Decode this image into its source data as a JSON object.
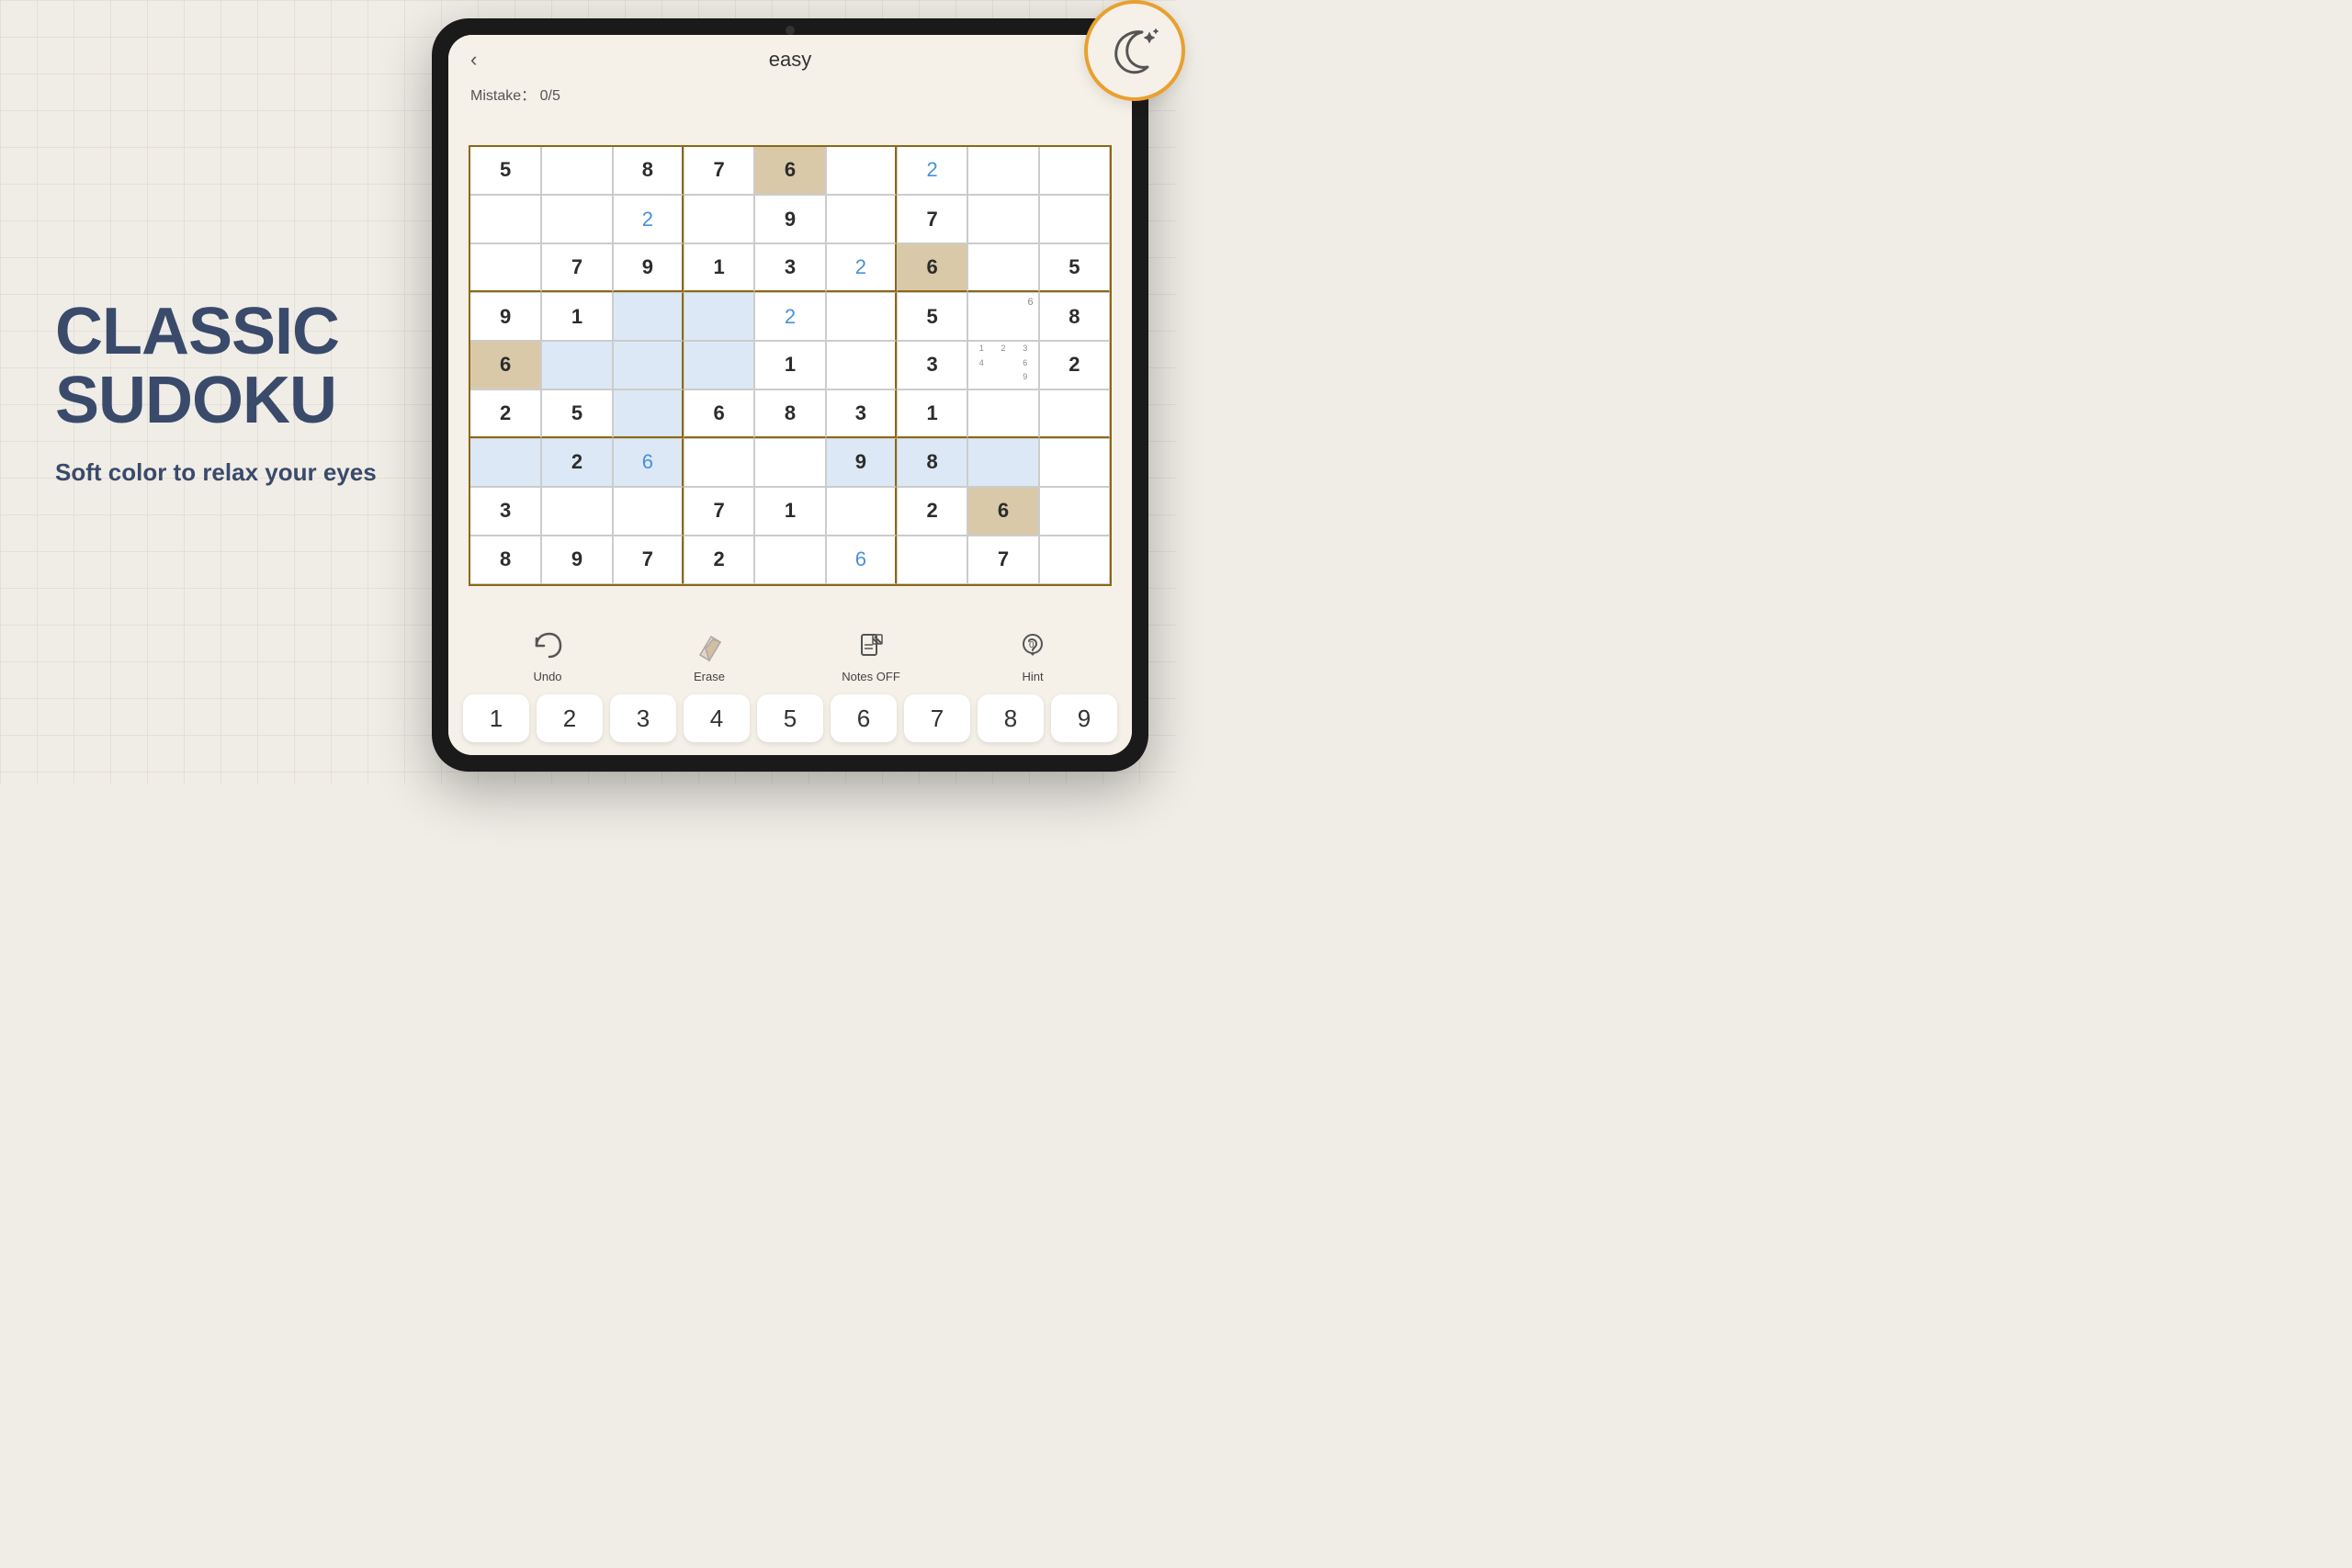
{
  "background": {
    "color": "#f0ede6"
  },
  "left": {
    "title_line1": "CLASSIC",
    "title_line2": "SUDOKU",
    "subtitle": "Soft color to relax your eyes"
  },
  "tablet": {
    "top_bar": {
      "back_label": "‹",
      "level": "easy",
      "mistake_label": "Mistake：",
      "mistake_value": "0/5"
    },
    "grid": {
      "cells": [
        {
          "row": 1,
          "col": 1,
          "value": "5",
          "type": "given",
          "bg": ""
        },
        {
          "row": 1,
          "col": 2,
          "value": "",
          "type": "given",
          "bg": ""
        },
        {
          "row": 1,
          "col": 3,
          "value": "8",
          "type": "given",
          "bg": ""
        },
        {
          "row": 1,
          "col": 4,
          "value": "7",
          "type": "given",
          "bg": ""
        },
        {
          "row": 1,
          "col": 5,
          "value": "6",
          "type": "given",
          "bg": "tan"
        },
        {
          "row": 1,
          "col": 6,
          "value": "",
          "type": "given",
          "bg": ""
        },
        {
          "row": 1,
          "col": 7,
          "value": "2",
          "type": "user-blue",
          "bg": ""
        },
        {
          "row": 1,
          "col": 8,
          "value": "",
          "type": "given",
          "bg": ""
        },
        {
          "row": 1,
          "col": 9,
          "value": "",
          "type": "given",
          "bg": ""
        },
        {
          "row": 2,
          "col": 1,
          "value": "",
          "type": "given",
          "bg": ""
        },
        {
          "row": 2,
          "col": 2,
          "value": "",
          "type": "given",
          "bg": ""
        },
        {
          "row": 2,
          "col": 3,
          "value": "2",
          "type": "user-blue",
          "bg": ""
        },
        {
          "row": 2,
          "col": 4,
          "value": "",
          "type": "given",
          "bg": ""
        },
        {
          "row": 2,
          "col": 5,
          "value": "9",
          "type": "given",
          "bg": ""
        },
        {
          "row": 2,
          "col": 6,
          "value": "",
          "type": "given",
          "bg": ""
        },
        {
          "row": 2,
          "col": 7,
          "value": "7",
          "type": "given",
          "bg": ""
        },
        {
          "row": 2,
          "col": 8,
          "value": "",
          "type": "given",
          "bg": ""
        },
        {
          "row": 2,
          "col": 9,
          "value": "",
          "type": "given",
          "bg": ""
        },
        {
          "row": 3,
          "col": 1,
          "value": "",
          "type": "given",
          "bg": ""
        },
        {
          "row": 3,
          "col": 2,
          "value": "7",
          "type": "given",
          "bg": ""
        },
        {
          "row": 3,
          "col": 3,
          "value": "9",
          "type": "given",
          "bg": ""
        },
        {
          "row": 3,
          "col": 4,
          "value": "1",
          "type": "given",
          "bg": ""
        },
        {
          "row": 3,
          "col": 5,
          "value": "3",
          "type": "given",
          "bg": ""
        },
        {
          "row": 3,
          "col": 6,
          "value": "2",
          "type": "user-blue",
          "bg": ""
        },
        {
          "row": 3,
          "col": 7,
          "value": "6",
          "type": "given",
          "bg": "tan"
        },
        {
          "row": 3,
          "col": 8,
          "value": "",
          "type": "given",
          "bg": ""
        },
        {
          "row": 3,
          "col": 9,
          "value": "5",
          "type": "given",
          "bg": ""
        },
        {
          "row": 4,
          "col": 1,
          "value": "9",
          "type": "given",
          "bg": ""
        },
        {
          "row": 4,
          "col": 2,
          "value": "1",
          "type": "given",
          "bg": ""
        },
        {
          "row": 4,
          "col": 3,
          "value": "",
          "type": "given",
          "bg": "blue"
        },
        {
          "row": 4,
          "col": 4,
          "value": "",
          "type": "given",
          "bg": "blue"
        },
        {
          "row": 4,
          "col": 5,
          "value": "2",
          "type": "user-blue",
          "bg": ""
        },
        {
          "row": 4,
          "col": 6,
          "value": "",
          "type": "given",
          "bg": ""
        },
        {
          "row": 4,
          "col": 7,
          "value": "5",
          "type": "given",
          "bg": ""
        },
        {
          "row": 4,
          "col": 8,
          "value": "6",
          "type": "note",
          "bg": ""
        },
        {
          "row": 4,
          "col": 9,
          "value": "8",
          "type": "given",
          "bg": ""
        },
        {
          "row": 5,
          "col": 1,
          "value": "6",
          "type": "given",
          "bg": "tan"
        },
        {
          "row": 5,
          "col": 2,
          "value": "",
          "type": "given",
          "bg": "blue"
        },
        {
          "row": 5,
          "col": 3,
          "value": "",
          "type": "given",
          "bg": "blue"
        },
        {
          "row": 5,
          "col": 4,
          "value": "",
          "type": "given",
          "bg": "blue"
        },
        {
          "row": 5,
          "col": 5,
          "value": "1",
          "type": "given",
          "bg": ""
        },
        {
          "row": 5,
          "col": 6,
          "value": "",
          "type": "given",
          "bg": ""
        },
        {
          "row": 5,
          "col": 7,
          "value": "3",
          "type": "given",
          "bg": ""
        },
        {
          "row": 5,
          "col": 8,
          "value": "notes469",
          "type": "notes",
          "bg": ""
        },
        {
          "row": 5,
          "col": 9,
          "value": "2",
          "type": "given",
          "bg": ""
        },
        {
          "row": 6,
          "col": 1,
          "value": "2",
          "type": "given",
          "bg": ""
        },
        {
          "row": 6,
          "col": 2,
          "value": "5",
          "type": "given",
          "bg": ""
        },
        {
          "row": 6,
          "col": 3,
          "value": "",
          "type": "given",
          "bg": "blue"
        },
        {
          "row": 6,
          "col": 4,
          "value": "6",
          "type": "given",
          "bg": ""
        },
        {
          "row": 6,
          "col": 5,
          "value": "8",
          "type": "given",
          "bg": ""
        },
        {
          "row": 6,
          "col": 6,
          "value": "3",
          "type": "given",
          "bg": ""
        },
        {
          "row": 6,
          "col": 7,
          "value": "1",
          "type": "given",
          "bg": ""
        },
        {
          "row": 6,
          "col": 8,
          "value": "",
          "type": "given",
          "bg": ""
        },
        {
          "row": 6,
          "col": 9,
          "value": "",
          "type": "given",
          "bg": ""
        },
        {
          "row": 7,
          "col": 1,
          "value": "",
          "type": "given",
          "bg": "blue"
        },
        {
          "row": 7,
          "col": 2,
          "value": "2",
          "type": "given",
          "bg": "blue"
        },
        {
          "row": 7,
          "col": 3,
          "value": "6",
          "type": "user-blue",
          "bg": "blue"
        },
        {
          "row": 7,
          "col": 4,
          "value": "",
          "type": "given",
          "bg": ""
        },
        {
          "row": 7,
          "col": 5,
          "value": "",
          "type": "given",
          "bg": ""
        },
        {
          "row": 7,
          "col": 6,
          "value": "9",
          "type": "given",
          "bg": "blue"
        },
        {
          "row": 7,
          "col": 7,
          "value": "8",
          "type": "given",
          "bg": "blue"
        },
        {
          "row": 7,
          "col": 8,
          "value": "",
          "type": "given",
          "bg": "blue"
        },
        {
          "row": 7,
          "col": 9,
          "value": "",
          "type": "given",
          "bg": ""
        },
        {
          "row": 8,
          "col": 1,
          "value": "3",
          "type": "given",
          "bg": ""
        },
        {
          "row": 8,
          "col": 2,
          "value": "",
          "type": "given",
          "bg": ""
        },
        {
          "row": 8,
          "col": 3,
          "value": "",
          "type": "given",
          "bg": ""
        },
        {
          "row": 8,
          "col": 4,
          "value": "7",
          "type": "given",
          "bg": ""
        },
        {
          "row": 8,
          "col": 5,
          "value": "1",
          "type": "given",
          "bg": ""
        },
        {
          "row": 8,
          "col": 6,
          "value": "",
          "type": "given",
          "bg": ""
        },
        {
          "row": 8,
          "col": 7,
          "value": "2",
          "type": "given",
          "bg": ""
        },
        {
          "row": 8,
          "col": 8,
          "value": "6",
          "type": "given",
          "bg": "tan"
        },
        {
          "row": 8,
          "col": 9,
          "value": "",
          "type": "given",
          "bg": ""
        },
        {
          "row": 9,
          "col": 1,
          "value": "8",
          "type": "given",
          "bg": ""
        },
        {
          "row": 9,
          "col": 2,
          "value": "9",
          "type": "given",
          "bg": ""
        },
        {
          "row": 9,
          "col": 3,
          "value": "7",
          "type": "given",
          "bg": ""
        },
        {
          "row": 9,
          "col": 4,
          "value": "2",
          "type": "given",
          "bg": ""
        },
        {
          "row": 9,
          "col": 5,
          "value": "",
          "type": "given",
          "bg": ""
        },
        {
          "row": 9,
          "col": 6,
          "value": "6",
          "type": "user-blue",
          "bg": ""
        },
        {
          "row": 9,
          "col": 7,
          "value": "",
          "type": "given",
          "bg": ""
        },
        {
          "row": 9,
          "col": 8,
          "value": "7",
          "type": "given",
          "bg": ""
        },
        {
          "row": 9,
          "col": 9,
          "value": "",
          "type": "given",
          "bg": ""
        }
      ]
    },
    "toolbar": {
      "undo_label": "Undo",
      "erase_label": "Erase",
      "notes_label": "Notes OFF",
      "hint_label": "Hint"
    },
    "numpad": [
      "1",
      "2",
      "3",
      "4",
      "5",
      "6",
      "7",
      "8",
      "9"
    ],
    "night_mode_label": "night-mode"
  }
}
